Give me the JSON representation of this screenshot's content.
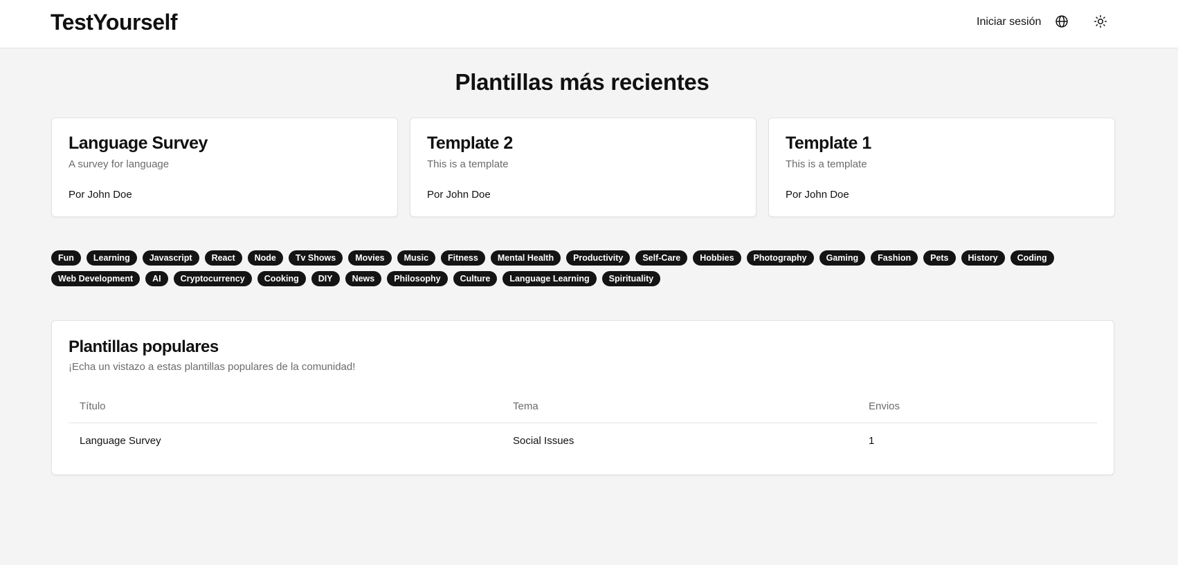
{
  "header": {
    "brand": "TestYourself",
    "login_label": "Iniciar sesión",
    "icons": [
      "globe-icon",
      "sun-icon"
    ]
  },
  "recent": {
    "title": "Plantillas más recientes",
    "cards": [
      {
        "title": "Language Survey",
        "description": "A survey for language",
        "author": "Por John Doe"
      },
      {
        "title": "Template 2",
        "description": "This is a template",
        "author": "Por John Doe"
      },
      {
        "title": "Template 1",
        "description": "This is a template",
        "author": "Por John Doe"
      }
    ]
  },
  "tags": [
    "Fun",
    "Learning",
    "Javascript",
    "React",
    "Node",
    "Tv Shows",
    "Movies",
    "Music",
    "Fitness",
    "Mental Health",
    "Productivity",
    "Self-Care",
    "Hobbies",
    "Photography",
    "Gaming",
    "Fashion",
    "Pets",
    "History",
    "Coding",
    "Web Development",
    "AI",
    "Cryptocurrency",
    "Cooking",
    "DIY",
    "News",
    "Philosophy",
    "Culture",
    "Language Learning",
    "Spirituality"
  ],
  "popular": {
    "title": "Plantillas populares",
    "subtitle": "¡Echa un vistazo a estas plantillas populares de la comunidad!",
    "columns": [
      "Título",
      "Tema",
      "Envios"
    ],
    "rows": [
      {
        "title": "Language Survey",
        "topic": "Social Issues",
        "submissions": "1"
      }
    ]
  }
}
